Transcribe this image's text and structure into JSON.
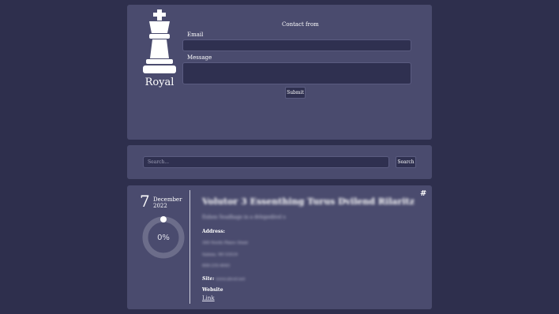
{
  "brand": {
    "name": "Royal",
    "logo_icon": "chess-king-icon"
  },
  "contact_form": {
    "title": "Contact from",
    "email_label": "Email",
    "email_value": "",
    "message_label": "Message",
    "message_value": "",
    "submit_label": "Submit"
  },
  "search": {
    "placeholder": "Search...",
    "button_label": "Search"
  },
  "event": {
    "day": "7",
    "month": "December",
    "year": "2022",
    "progress_percent": 0,
    "progress_label": "0%",
    "title": "Volutor 3 Essenthing Turus Dvilend Rilaritz",
    "subtitle": "Enhen Seadhags in a dvlepedivel s",
    "address_label": "Address:",
    "address_lines": [
      "300 North Phnro Stent",
      "Salene, WI 53519",
      "608-235-4043"
    ],
    "site_label": "Site:",
    "site_value": "www.abcel.net",
    "website_label": "Website",
    "website_link_text": "Link",
    "pin_icon": "hash-icon"
  },
  "colors": {
    "background": "#2e2f4d",
    "card": "#4a4b6e",
    "input": "#2f3050",
    "progress_ring": "#6c6d8a",
    "progress_knob": "#ffffff"
  }
}
